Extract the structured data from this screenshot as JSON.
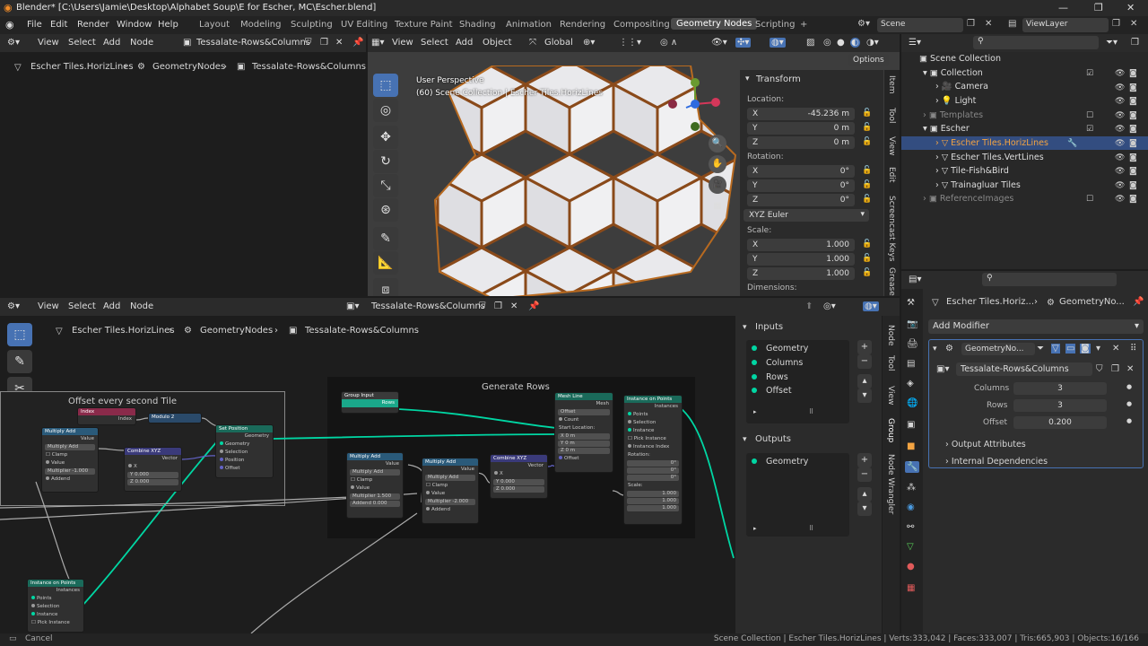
{
  "window": {
    "title": "Blender* [C:\\Users\\Jamie\\Desktop\\Alphabet Soup\\E for Escher, MC\\Escher.blend]"
  },
  "menu": [
    "File",
    "Edit",
    "Render",
    "Window",
    "Help"
  ],
  "workspaces": [
    "Layout",
    "Modeling",
    "Sculpting",
    "UV Editing",
    "Texture Paint",
    "Shading",
    "Animation",
    "Rendering",
    "Compositing",
    "Geometry Nodes",
    "Scripting"
  ],
  "active_workspace": "Geometry Nodes",
  "scene": {
    "label": "Scene",
    "view_layer": "ViewLayer"
  },
  "top_node_editor": {
    "menus": [
      "View",
      "Select",
      "Add",
      "Node"
    ],
    "nodetree": "Tessalate-Rows&Columns",
    "breadcrumb": [
      "Escher Tiles.HorizLines",
      "GeometryNodes",
      "Tessalate-Rows&Columns"
    ]
  },
  "viewport": {
    "menus": [
      "View",
      "Select",
      "Add",
      "Object"
    ],
    "orientation": "Global",
    "options": "Options",
    "overlay_title": "User Perspective",
    "overlay_subtitle": "(60) Scene Collection | Escher Tiles.HorizLines",
    "transform": {
      "title": "Transform",
      "location_label": "Location:",
      "location": [
        {
          "axis": "X",
          "value": "-45.236 m"
        },
        {
          "axis": "Y",
          "value": "0 m"
        },
        {
          "axis": "Z",
          "value": "0 m"
        }
      ],
      "rotation_label": "Rotation:",
      "rotation": [
        {
          "axis": "X",
          "value": "0°"
        },
        {
          "axis": "Y",
          "value": "0°"
        },
        {
          "axis": "Z",
          "value": "0°"
        }
      ],
      "rotation_mode": "XYZ Euler",
      "scale_label": "Scale:",
      "scale": [
        {
          "axis": "X",
          "value": "1.000"
        },
        {
          "axis": "Y",
          "value": "1.000"
        },
        {
          "axis": "Z",
          "value": "1.000"
        }
      ],
      "dimensions_label": "Dimensions:"
    },
    "side_tabs": [
      "Item",
      "Tool",
      "View",
      "Edit",
      "Screencast Keys",
      "Grease"
    ]
  },
  "outliner": {
    "items": [
      {
        "label": "Scene Collection"
      },
      {
        "label": "Collection"
      },
      {
        "label": "Camera"
      },
      {
        "label": "Light"
      },
      {
        "label": "Templates"
      },
      {
        "label": "Escher"
      },
      {
        "label": "Escher Tiles.HorizLines"
      },
      {
        "label": "Escher Tiles.VertLines"
      },
      {
        "label": "Tile-Fish&Bird"
      },
      {
        "label": "Trainagluar Tiles"
      },
      {
        "label": "ReferenceImages"
      }
    ]
  },
  "node_editor": {
    "menus": [
      "View",
      "Select",
      "Add",
      "Node"
    ],
    "nodetree": "Tessalate-Rows&Columns",
    "breadcrumb": [
      "Escher Tiles.HorizLines",
      "GeometryNodes",
      "Tessalate-Rows&Columns"
    ],
    "frames": {
      "offset": "Offset every second Tile",
      "generate": "Generate Rows"
    },
    "nodes": {
      "index": "Index",
      "index_out": "Index",
      "modulo": "Modulo 2",
      "multiply_add_1": {
        "title": "Multiply Add",
        "value": "Value",
        "op": "Multiply Add",
        "clamp": "Clamp",
        "in": "Value",
        "multiplier": "Multiplier",
        "mult_val": "-1.000",
        "addend": "Addend"
      },
      "combine_1": {
        "title": "Combine XYZ",
        "vector": "Vector",
        "x": "X",
        "y": "Y",
        "y_val": "0.000",
        "z": "Z",
        "z_val": "0.000"
      },
      "set_position": {
        "title": "Set Position",
        "geometry": "Geometry",
        "g_in": "Geometry",
        "selection": "Selection",
        "position": "Position",
        "offset": "Offset"
      },
      "group_input": {
        "title": "Group Input",
        "rows": "Rows"
      },
      "multiply_add_2": {
        "title": "Multiply Add",
        "value": "Value",
        "op": "Multiply Add",
        "clamp": "Clamp",
        "in": "Value",
        "multiplier": "Multiplier",
        "mult_val": "1.500",
        "addend": "Addend",
        "add_val": "0.000"
      },
      "multiply_add_3": {
        "title": "Multiply Add",
        "value": "Value",
        "op": "Multiply Add",
        "clamp": "Clamp",
        "in": "Value",
        "multiplier": "Multiplier",
        "mult_val": "-2.000",
        "addend": "Addend"
      },
      "combine_2": {
        "title": "Combine XYZ",
        "vector": "Vector",
        "x": "X",
        "y": "Y",
        "y_val": "0.000",
        "z": "Z",
        "z_val": "0.000"
      },
      "mesh_line": {
        "title": "Mesh Line",
        "mesh": "Mesh",
        "mode": "Offset",
        "count": "Count",
        "start": "Start Location:",
        "x": "X",
        "x_val": "0 m",
        "y": "Y",
        "y_val": "0 m",
        "z": "Z",
        "z_val": "0 m",
        "offset": "Offset"
      },
      "instance_points": {
        "title": "Instance on Points",
        "instances": "Instances",
        "points": "Points",
        "selection": "Selection",
        "instance": "Instance",
        "pick": "Pick Instance",
        "index": "Instance Index",
        "rotation": "Rotation:",
        "rx": "0°",
        "ry": "0°",
        "rz": "0°",
        "scale": "Scale:",
        "sx": "1.000",
        "sy": "1.000",
        "sz": "1.000"
      },
      "instance_points_2": {
        "title": "Instance on Points",
        "instances": "Instances",
        "points": "Points",
        "selection": "Selection",
        "instance": "Instance",
        "pick": "Pick Instance"
      }
    },
    "inputs_title": "Inputs",
    "inputs": [
      "Geometry",
      "Columns",
      "Rows",
      "Offset"
    ],
    "outputs_title": "Outputs",
    "outputs": [
      "Geometry"
    ],
    "side_tabs": [
      "Node",
      "Tool",
      "View",
      "Group",
      "Node Wrangler"
    ]
  },
  "properties": {
    "breadcrumb": [
      "Escher Tiles.Horiz...",
      "GeometryNo..."
    ],
    "add_modifier": "Add Modifier",
    "modifier_name": "GeometryNo...",
    "nodetree": "Tessalate-Rows&Columns",
    "fields": [
      {
        "label": "Columns",
        "value": "3"
      },
      {
        "label": "Rows",
        "value": "3"
      },
      {
        "label": "Offset",
        "value": "0.200"
      }
    ],
    "output_attributes": "Output Attributes",
    "internal_dependencies": "Internal Dependencies"
  },
  "status_bar": {
    "left": "Cancel",
    "right": "Scene Collection | Escher Tiles.HorizLines | Verts:333,042 | Faces:333,007 | Tris:665,903 | Objects:16/166"
  },
  "colors": {
    "accent": "#4772b3",
    "geometry_socket": "#00d6a3",
    "vector_socket": "#6363c7",
    "selected": "#334d80"
  }
}
